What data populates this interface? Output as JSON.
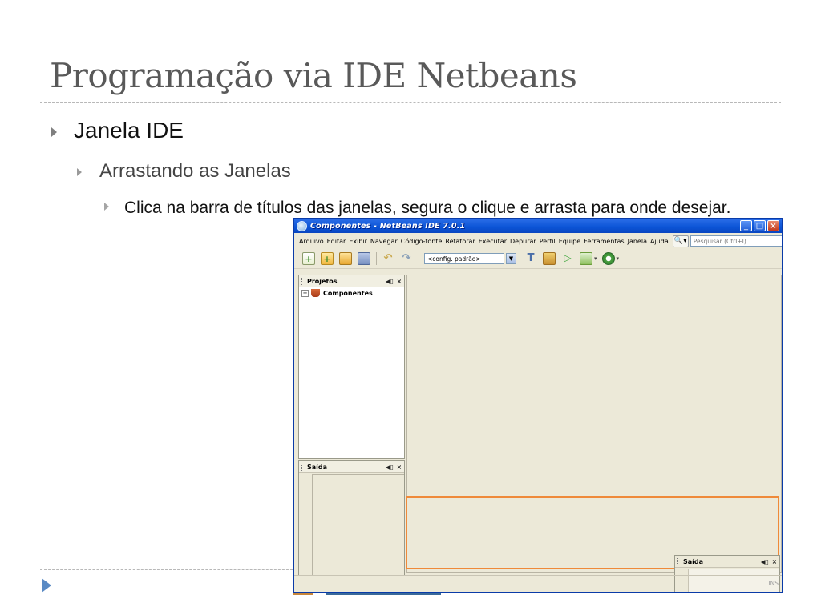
{
  "slide": {
    "title": "Programação via IDE Netbeans",
    "bullet1": "Janela IDE",
    "bullet2": "Arrastando as Janelas",
    "bullet3": "Clica na barra de títulos das janelas, segura o clique e arrasta para onde desejar."
  },
  "window": {
    "title": "Componentes - NetBeans IDE 7.0.1",
    "controls": {
      "minimize": "_",
      "maximize": "□",
      "close": "×"
    }
  },
  "menu": [
    "Arquivo",
    "Editar",
    "Exibir",
    "Navegar",
    "Código-fonte",
    "Refatorar",
    "Executar",
    "Depurar",
    "Perfil",
    "Equipe",
    "Ferramentas",
    "Janela",
    "Ajuda"
  ],
  "search": {
    "icon": "search-icon",
    "placeholder": "Pesquisar (Ctrl+I)"
  },
  "toolbar": {
    "icons": [
      "new-file-icon",
      "new-project-icon",
      "open-project-icon",
      "save-all-icon",
      "undo-icon",
      "redo-icon",
      "build-icon",
      "clean-build-icon",
      "run-icon",
      "debug-icon",
      "profile-icon"
    ],
    "config_value": "<config. padrão>"
  },
  "projects_panel": {
    "title": "Projetos",
    "pin": "◀▯",
    "close": "×",
    "tree": [
      {
        "toggle": "+",
        "label": "Componentes"
      }
    ]
  },
  "output_panel": {
    "title": "Saída",
    "pin": "◀▯",
    "close": "×"
  },
  "output_panel_floating": {
    "title": "Saída",
    "pin": "◀▯",
    "close": "×"
  },
  "statusbar": {
    "mode": "INS"
  },
  "colors": {
    "titlebar": "#0b54d6",
    "drop_target": "#ef8a3a",
    "window_bg": "#ece9d8",
    "accent_blue": "#5a8ac4"
  }
}
